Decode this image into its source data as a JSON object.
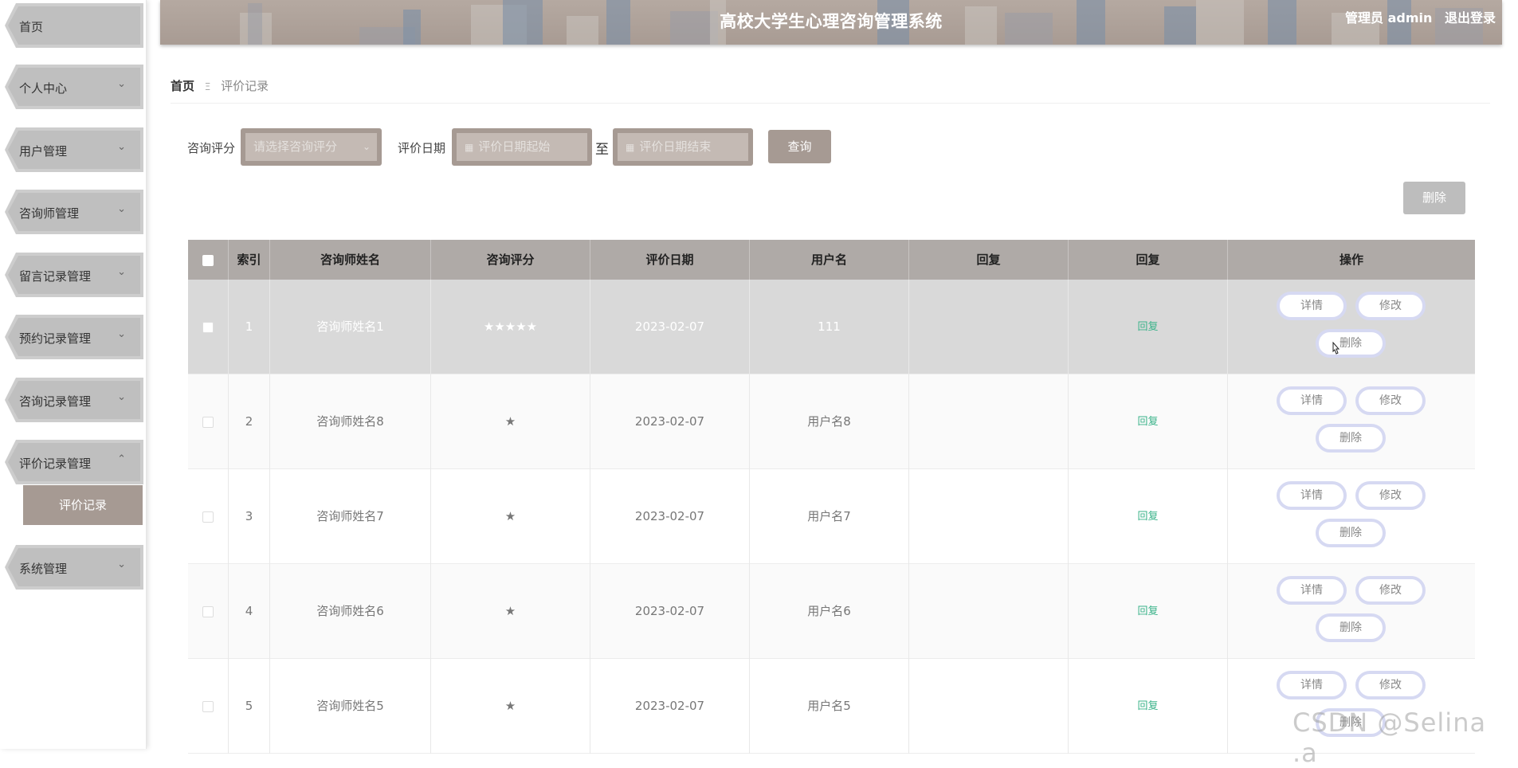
{
  "header": {
    "title": "高校大学生心理咨询管理系统",
    "user_label": "管理员 admin",
    "logout": "退出登录"
  },
  "sidebar": {
    "items": [
      {
        "label": "首页",
        "chev": ""
      },
      {
        "label": "个人中心",
        "chev": "⌄"
      },
      {
        "label": "用户管理",
        "chev": "⌄"
      },
      {
        "label": "咨询师管理",
        "chev": "⌄"
      },
      {
        "label": "留言记录管理",
        "chev": "⌄"
      },
      {
        "label": "预约记录管理",
        "chev": "⌄"
      },
      {
        "label": "咨询记录管理",
        "chev": "⌄"
      },
      {
        "label": "评价记录管理",
        "chev": "⌃"
      },
      {
        "label": "系统管理",
        "chev": "⌄"
      }
    ],
    "sub_active": "评价记录"
  },
  "breadcrumb": {
    "home": "首页",
    "sep": "Ξ",
    "current": "评价记录"
  },
  "filters": {
    "rating_label": "咨询评分",
    "rating_placeholder": "请选择咨询评分",
    "date_label": "评价日期",
    "date_start_placeholder": "评价日期起始",
    "date_to": "至",
    "date_end_placeholder": "评价日期结束",
    "query_button": "查询",
    "delete_button": "删除"
  },
  "table": {
    "headers": [
      "索引",
      "咨询师姓名",
      "咨询评分",
      "评价日期",
      "用户名",
      "回复",
      "回复",
      "操作"
    ],
    "rows": [
      {
        "index": "1",
        "name": "咨询师姓名1",
        "rating": "★★★★★",
        "date": "2023-02-07",
        "user": "111",
        "reply": "",
        "reply_link": "回复"
      },
      {
        "index": "2",
        "name": "咨询师姓名8",
        "rating": "★",
        "date": "2023-02-07",
        "user": "用户名8",
        "reply": "",
        "reply_link": "回复"
      },
      {
        "index": "3",
        "name": "咨询师姓名7",
        "rating": "★",
        "date": "2023-02-07",
        "user": "用户名7",
        "reply": "",
        "reply_link": "回复"
      },
      {
        "index": "4",
        "name": "咨询师姓名6",
        "rating": "★",
        "date": "2023-02-07",
        "user": "用户名6",
        "reply": "",
        "reply_link": "回复"
      },
      {
        "index": "5",
        "name": "咨询师姓名5",
        "rating": "★",
        "date": "2023-02-07",
        "user": "用户名5",
        "reply": "",
        "reply_link": "回复"
      }
    ],
    "actions": {
      "detail": "详情",
      "edit": "修改",
      "delete": "删除"
    }
  },
  "watermark": "CSDN @Selina .a",
  "icons": {
    "calendar": "calendar-icon",
    "dropdown": "chevron-down-icon"
  }
}
